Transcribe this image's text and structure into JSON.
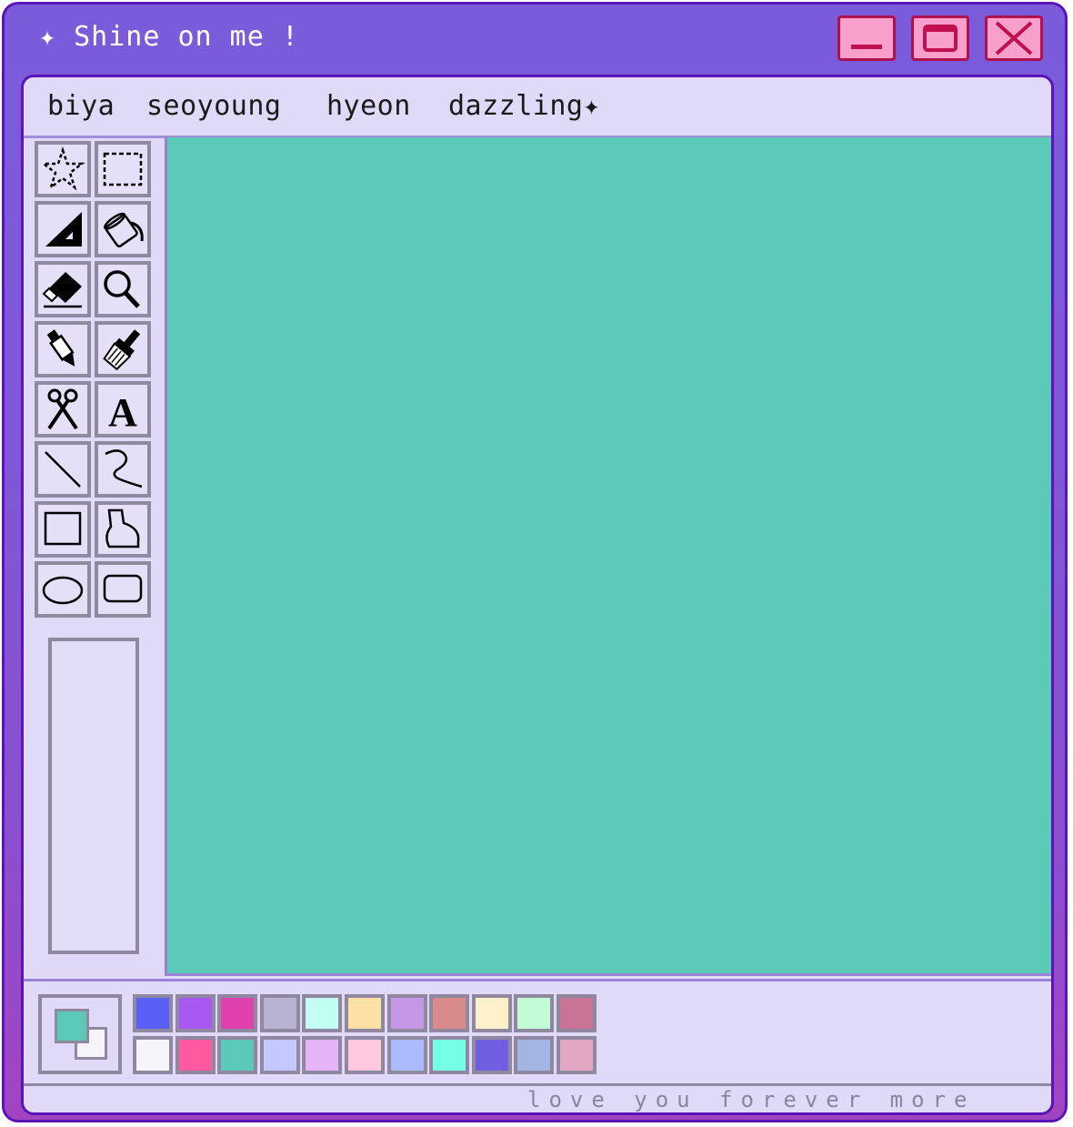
{
  "window": {
    "title": "✦ Shine on me !",
    "buttons": {
      "minimize": "minimize",
      "maximize": "maximize",
      "close": "close"
    }
  },
  "menu": {
    "items": [
      "biya",
      "seoyoung",
      "hyeon",
      "dazzling✦"
    ]
  },
  "tools": [
    {
      "name": "free-form-select",
      "icon": "star-select-icon"
    },
    {
      "name": "rect-select",
      "icon": "rect-select-icon"
    },
    {
      "name": "triangle",
      "icon": "triangle-ruler-icon"
    },
    {
      "name": "fill",
      "icon": "paint-bucket-icon"
    },
    {
      "name": "eraser",
      "icon": "eraser-icon"
    },
    {
      "name": "magnifier",
      "icon": "magnifier-icon"
    },
    {
      "name": "pen",
      "icon": "pen-icon"
    },
    {
      "name": "brush",
      "icon": "brush-icon"
    },
    {
      "name": "scissors",
      "icon": "scissors-icon"
    },
    {
      "name": "text",
      "icon": "text-icon",
      "glyph": "A"
    },
    {
      "name": "line",
      "icon": "line-icon"
    },
    {
      "name": "curve",
      "icon": "curve-icon"
    },
    {
      "name": "rectangle",
      "icon": "rectangle-icon"
    },
    {
      "name": "polygon",
      "icon": "polygon-icon"
    },
    {
      "name": "ellipse",
      "icon": "ellipse-icon"
    },
    {
      "name": "rounded-rect",
      "icon": "rounded-rect-icon"
    }
  ],
  "canvas": {
    "color": "#5ccab9"
  },
  "current_colors": {
    "foreground": "#5ccab9",
    "background": "#f6f4fb"
  },
  "palette": {
    "row1": [
      "#5a5ff8",
      "#a758f2",
      "#e041ad",
      "#b8b3d2",
      "#c2fef2",
      "#fde0a4",
      "#c498e4",
      "#d98b8b",
      "#fef0c8",
      "#c2fcd4",
      "#c97497"
    ],
    "row2": [
      "#f6f4fb",
      "#ff5aa0",
      "#5ccab9",
      "#c3c9fe",
      "#e4b4f6",
      "#ffc8de",
      "#abbcfe",
      "#75ffe7",
      "#705ee0",
      "#a3b5e2",
      "#e2a8c3"
    ]
  },
  "status": {
    "text": "love you forever more"
  }
}
